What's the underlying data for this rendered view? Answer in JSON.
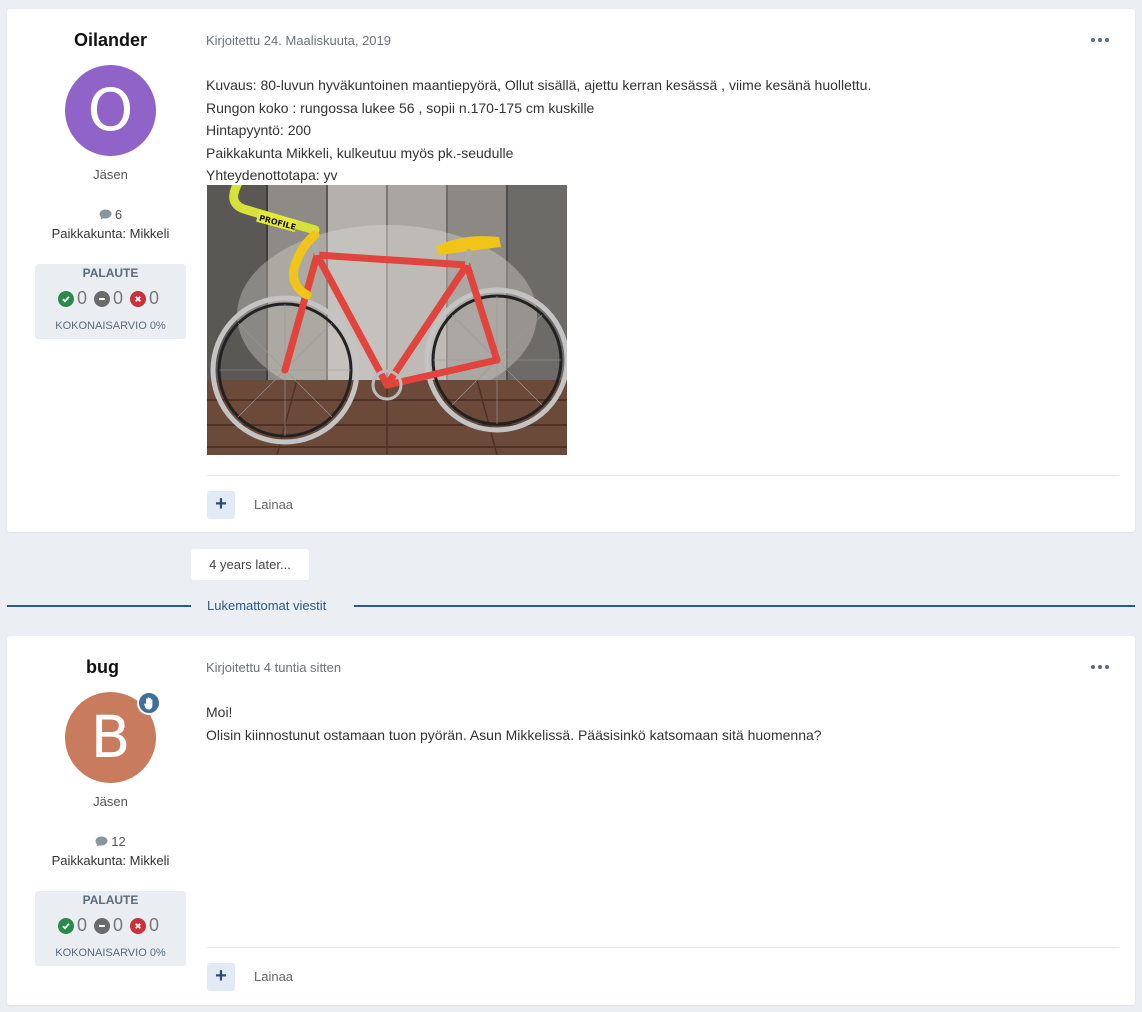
{
  "posts": [
    {
      "author": "Oilander",
      "avatar_letter": "O",
      "avatar_color": "#8f63c7",
      "role": "Jäsen",
      "post_count": "6",
      "location": "Paikkakunta: Mikkeli",
      "feedback": {
        "title": "PALAUTE",
        "positive": "0",
        "neutral": "0",
        "negative": "0",
        "summary": "KOKONAISARVIO 0%"
      },
      "timestamp": "Kirjoitettu 24. Maaliskuuta, 2019",
      "lines": [
        "Kuvaus: 80-luvun hyväkuntoinen maantiepyörä, Ollut sisällä, ajettu kerran kesässä , viime kesänä huollettu.",
        "Rungon koko : rungossa lukee 56 , sopii n.170-175 cm kuskille",
        "Hintapyyntö: 200",
        "Paikkakunta Mikkeli, kulkeutuu myös pk.-seudulle",
        "Yhteydenottotapa: yv"
      ],
      "image_label": "PROFILE",
      "quote_label": "Lainaa",
      "plus_label": "+"
    },
    {
      "author": "bug",
      "avatar_letter": "B",
      "avatar_color": "#c97b5e",
      "role": "Jäsen",
      "post_count": "12",
      "location": "Paikkakunta: Mikkeli",
      "feedback": {
        "title": "PALAUTE",
        "positive": "0",
        "neutral": "0",
        "negative": "0",
        "summary": "KOKONAISARVIO 0%"
      },
      "timestamp": "Kirjoitettu 4 tuntia sitten",
      "lines": [
        "Moi!",
        "Olisin kiinnostunut ostamaan tuon pyörän. Asun Mikkelissä. Pääsisinkö katsomaan sitä huomenna?"
      ],
      "quote_label": "Lainaa",
      "plus_label": "+"
    }
  ],
  "time_gap": "4 years later...",
  "unread_label": "Lukemattomat viestit",
  "colors": {
    "background": "#ebeef2",
    "accent": "#2b5a85",
    "positive": "#2b8a4b",
    "neutral": "#6b6b6b",
    "negative": "#c8323a"
  },
  "icons": {
    "post_count": "comment-icon",
    "moderator": "hand-icon",
    "more": "ellipsis-icon"
  }
}
